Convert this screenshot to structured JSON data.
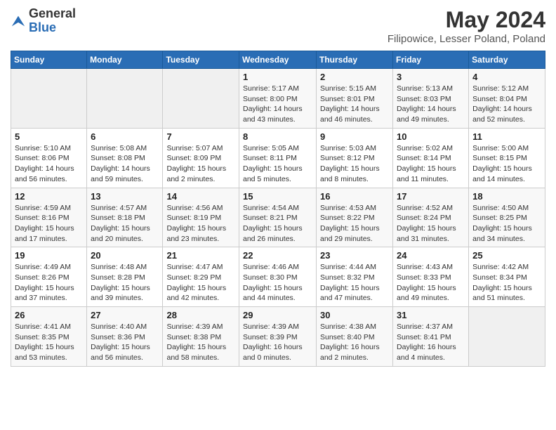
{
  "header": {
    "logo_general": "General",
    "logo_blue": "Blue",
    "main_title": "May 2024",
    "sub_title": "Filipowice, Lesser Poland, Poland"
  },
  "calendar": {
    "days_of_week": [
      "Sunday",
      "Monday",
      "Tuesday",
      "Wednesday",
      "Thursday",
      "Friday",
      "Saturday"
    ],
    "weeks": [
      [
        {
          "day": "",
          "info": ""
        },
        {
          "day": "",
          "info": ""
        },
        {
          "day": "",
          "info": ""
        },
        {
          "day": "1",
          "info": "Sunrise: 5:17 AM\nSunset: 8:00 PM\nDaylight: 14 hours\nand 43 minutes."
        },
        {
          "day": "2",
          "info": "Sunrise: 5:15 AM\nSunset: 8:01 PM\nDaylight: 14 hours\nand 46 minutes."
        },
        {
          "day": "3",
          "info": "Sunrise: 5:13 AM\nSunset: 8:03 PM\nDaylight: 14 hours\nand 49 minutes."
        },
        {
          "day": "4",
          "info": "Sunrise: 5:12 AM\nSunset: 8:04 PM\nDaylight: 14 hours\nand 52 minutes."
        }
      ],
      [
        {
          "day": "5",
          "info": "Sunrise: 5:10 AM\nSunset: 8:06 PM\nDaylight: 14 hours\nand 56 minutes."
        },
        {
          "day": "6",
          "info": "Sunrise: 5:08 AM\nSunset: 8:08 PM\nDaylight: 14 hours\nand 59 minutes."
        },
        {
          "day": "7",
          "info": "Sunrise: 5:07 AM\nSunset: 8:09 PM\nDaylight: 15 hours\nand 2 minutes."
        },
        {
          "day": "8",
          "info": "Sunrise: 5:05 AM\nSunset: 8:11 PM\nDaylight: 15 hours\nand 5 minutes."
        },
        {
          "day": "9",
          "info": "Sunrise: 5:03 AM\nSunset: 8:12 PM\nDaylight: 15 hours\nand 8 minutes."
        },
        {
          "day": "10",
          "info": "Sunrise: 5:02 AM\nSunset: 8:14 PM\nDaylight: 15 hours\nand 11 minutes."
        },
        {
          "day": "11",
          "info": "Sunrise: 5:00 AM\nSunset: 8:15 PM\nDaylight: 15 hours\nand 14 minutes."
        }
      ],
      [
        {
          "day": "12",
          "info": "Sunrise: 4:59 AM\nSunset: 8:16 PM\nDaylight: 15 hours\nand 17 minutes."
        },
        {
          "day": "13",
          "info": "Sunrise: 4:57 AM\nSunset: 8:18 PM\nDaylight: 15 hours\nand 20 minutes."
        },
        {
          "day": "14",
          "info": "Sunrise: 4:56 AM\nSunset: 8:19 PM\nDaylight: 15 hours\nand 23 minutes."
        },
        {
          "day": "15",
          "info": "Sunrise: 4:54 AM\nSunset: 8:21 PM\nDaylight: 15 hours\nand 26 minutes."
        },
        {
          "day": "16",
          "info": "Sunrise: 4:53 AM\nSunset: 8:22 PM\nDaylight: 15 hours\nand 29 minutes."
        },
        {
          "day": "17",
          "info": "Sunrise: 4:52 AM\nSunset: 8:24 PM\nDaylight: 15 hours\nand 31 minutes."
        },
        {
          "day": "18",
          "info": "Sunrise: 4:50 AM\nSunset: 8:25 PM\nDaylight: 15 hours\nand 34 minutes."
        }
      ],
      [
        {
          "day": "19",
          "info": "Sunrise: 4:49 AM\nSunset: 8:26 PM\nDaylight: 15 hours\nand 37 minutes."
        },
        {
          "day": "20",
          "info": "Sunrise: 4:48 AM\nSunset: 8:28 PM\nDaylight: 15 hours\nand 39 minutes."
        },
        {
          "day": "21",
          "info": "Sunrise: 4:47 AM\nSunset: 8:29 PM\nDaylight: 15 hours\nand 42 minutes."
        },
        {
          "day": "22",
          "info": "Sunrise: 4:46 AM\nSunset: 8:30 PM\nDaylight: 15 hours\nand 44 minutes."
        },
        {
          "day": "23",
          "info": "Sunrise: 4:44 AM\nSunset: 8:32 PM\nDaylight: 15 hours\nand 47 minutes."
        },
        {
          "day": "24",
          "info": "Sunrise: 4:43 AM\nSunset: 8:33 PM\nDaylight: 15 hours\nand 49 minutes."
        },
        {
          "day": "25",
          "info": "Sunrise: 4:42 AM\nSunset: 8:34 PM\nDaylight: 15 hours\nand 51 minutes."
        }
      ],
      [
        {
          "day": "26",
          "info": "Sunrise: 4:41 AM\nSunset: 8:35 PM\nDaylight: 15 hours\nand 53 minutes."
        },
        {
          "day": "27",
          "info": "Sunrise: 4:40 AM\nSunset: 8:36 PM\nDaylight: 15 hours\nand 56 minutes."
        },
        {
          "day": "28",
          "info": "Sunrise: 4:39 AM\nSunset: 8:38 PM\nDaylight: 15 hours\nand 58 minutes."
        },
        {
          "day": "29",
          "info": "Sunrise: 4:39 AM\nSunset: 8:39 PM\nDaylight: 16 hours\nand 0 minutes."
        },
        {
          "day": "30",
          "info": "Sunrise: 4:38 AM\nSunset: 8:40 PM\nDaylight: 16 hours\nand 2 minutes."
        },
        {
          "day": "31",
          "info": "Sunrise: 4:37 AM\nSunset: 8:41 PM\nDaylight: 16 hours\nand 4 minutes."
        },
        {
          "day": "",
          "info": ""
        }
      ]
    ]
  }
}
